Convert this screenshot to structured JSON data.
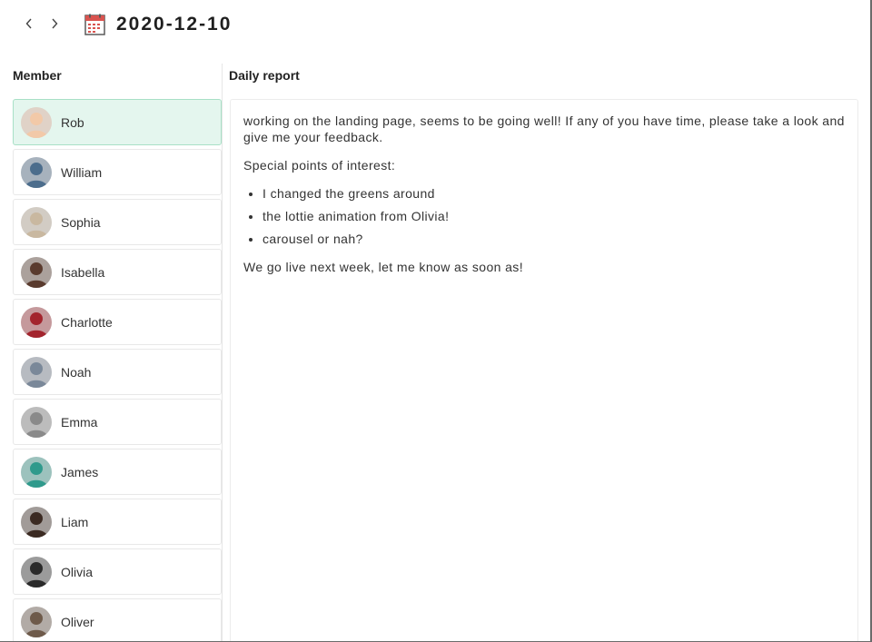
{
  "header": {
    "prev_label": "‹",
    "next_label": "›",
    "date": "2020-12-10"
  },
  "columns": {
    "member": "Member",
    "report": "Daily report"
  },
  "members": [
    {
      "name": "Rob",
      "selected": true,
      "avatar_color": "#f2c9a8"
    },
    {
      "name": "William",
      "selected": false,
      "avatar_color": "#4c6d8c"
    },
    {
      "name": "Sophia",
      "selected": false,
      "avatar_color": "#c9b8a0"
    },
    {
      "name": "Isabella",
      "selected": false,
      "avatar_color": "#5a3b2e"
    },
    {
      "name": "Charlotte",
      "selected": false,
      "avatar_color": "#a3242d"
    },
    {
      "name": "Noah",
      "selected": false,
      "avatar_color": "#7a8899"
    },
    {
      "name": "Emma",
      "selected": false,
      "avatar_color": "#8a8a8a"
    },
    {
      "name": "James",
      "selected": false,
      "avatar_color": "#2f9a8c"
    },
    {
      "name": "Liam",
      "selected": false,
      "avatar_color": "#3b2a22"
    },
    {
      "name": "Olivia",
      "selected": false,
      "avatar_color": "#2a2a2a"
    },
    {
      "name": "Oliver",
      "selected": false,
      "avatar_color": "#6e5a4a"
    }
  ],
  "report": {
    "intro": "working on the landing page, seems to be going well! If any of you have time, please take a look and give me your feedback.",
    "points_heading": "Special points of interest:",
    "points": [
      "I changed the greens around",
      "the lottie animation from Olivia!",
      "carousel or nah?"
    ],
    "closing": "We go live next week, let me know as soon as!"
  },
  "colors": {
    "selected_bg": "#e4f6ee",
    "selected_border": "#a8e0c6",
    "calendar_red": "#d9534f"
  },
  "icons": {
    "prev": "chevron-left-icon",
    "next": "chevron-right-icon",
    "calendar": "calendar-icon",
    "avatar": "avatar-photo"
  }
}
